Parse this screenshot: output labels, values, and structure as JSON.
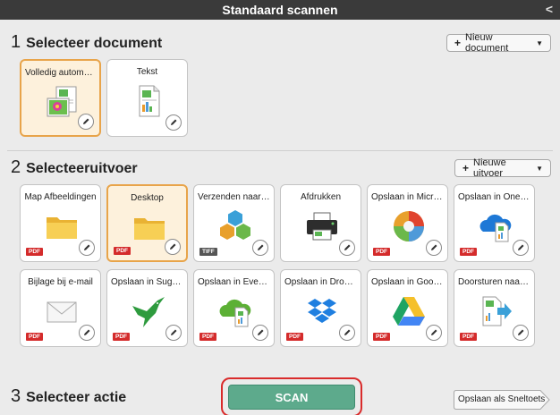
{
  "window": {
    "title": "Standaard scannen",
    "back_glyph": "<"
  },
  "section1": {
    "number": "1",
    "title": "Selecteer document",
    "new_button": {
      "plus": "+",
      "label": "Nieuw document",
      "caret": "▼"
    },
    "cards": [
      {
        "label": "Volledig automatis...",
        "icon": "auto-document-icon",
        "selected": true
      },
      {
        "label": "Tekst",
        "icon": "text-document-icon",
        "selected": false
      }
    ]
  },
  "section2": {
    "number": "2",
    "title": "Selecteeruitvoer",
    "new_button": {
      "plus": "+",
      "label": "Nieuwe uitvoer",
      "caret": "▼"
    },
    "cards": [
      {
        "label": "Map Afbeeldingen",
        "icon": "folder-icon",
        "badge": "PDF",
        "selected": false
      },
      {
        "label": "Desktop",
        "icon": "folder-icon",
        "badge": "PDF",
        "selected": true
      },
      {
        "label": "Verzenden naar eC...",
        "icon": "hexagon-app-icon",
        "badge": "TIFF",
        "selected": false
      },
      {
        "label": "Afdrukken",
        "icon": "printer-icon",
        "badge": "",
        "selected": false
      },
      {
        "label": "Opslaan in Micros...",
        "icon": "sharepoint-icon",
        "badge": "PDF",
        "selected": false
      },
      {
        "label": "Opslaan in OneDri...",
        "icon": "onedrive-icon",
        "badge": "PDF",
        "selected": false
      },
      {
        "label": "Bijlage bij e-mail",
        "icon": "envelope-icon",
        "badge": "PDF",
        "selected": false
      },
      {
        "label": "Opslaan in SugarS...",
        "icon": "hummingbird-icon",
        "badge": "PDF",
        "selected": false
      },
      {
        "label": "Opslaan in Evernote",
        "icon": "evernote-cloud-icon",
        "badge": "PDF",
        "selected": false
      },
      {
        "label": "Opslaan in Dropbox",
        "icon": "dropbox-icon",
        "badge": "PDF",
        "selected": false
      },
      {
        "label": "Opslaan in Google...",
        "icon": "google-drive-icon",
        "badge": "PDF",
        "selected": false
      },
      {
        "label": "Doorsturen naar t...",
        "icon": "forward-document-icon",
        "badge": "PDF",
        "selected": false
      }
    ]
  },
  "section3": {
    "number": "3",
    "title": "Selecteer actie",
    "scan_label": "SCAN",
    "shortcut_label": "Opslaan als Sneltoets"
  },
  "colors": {
    "titlebar": "#3a3a3a",
    "selected_border": "#e8a44a",
    "scan_green": "#5daa8c",
    "scan_highlight": "#d92b2b",
    "pdf_badge": "#d42b2b"
  }
}
